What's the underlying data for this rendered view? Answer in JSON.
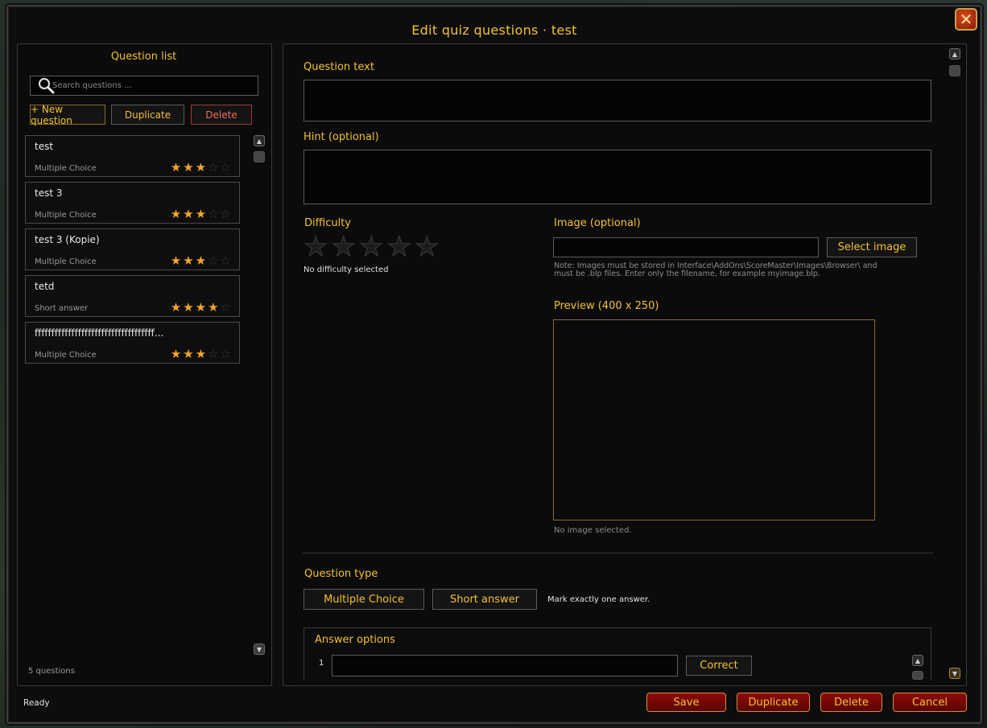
{
  "window": {
    "title": "Edit quiz questions · test",
    "close_glyph": "✕"
  },
  "sidebar": {
    "heading": "Question list",
    "search_placeholder": "Search questions ...",
    "new_label": "+ New question",
    "duplicate_label": "Duplicate",
    "delete_label": "Delete",
    "items": [
      {
        "title": "test",
        "type": "Multiple Choice",
        "difficulty": 3
      },
      {
        "title": "test 3",
        "type": "Multiple Choice",
        "difficulty": 3
      },
      {
        "title": "test 3 (Kopie)",
        "type": "Multiple Choice",
        "difficulty": 3
      },
      {
        "title": "tetd",
        "type": "Short answer",
        "difficulty": 4
      },
      {
        "title": "ffffffffffffffffffffffffffffffffffff...",
        "type": "Multiple Choice",
        "difficulty": 3
      }
    ],
    "count_text": "5 questions"
  },
  "editor": {
    "question_label": "Question text",
    "question_value": "",
    "hint_label": "Hint (optional)",
    "hint_value": "",
    "difficulty_label": "Difficulty",
    "difficulty_value": 0,
    "difficulty_status": "No difficulty selected",
    "image_label": "Image (optional)",
    "image_value": "",
    "select_image_label": "Select image",
    "image_note": "Note: Images must be stored in Interface\\AddOns\\ScoreMaster\\Images\\Browser\\ and must be .blp files. Enter only the filename, for example myimage.blp.",
    "preview_label": "Preview (400 x 250)",
    "preview_status": "No image selected.",
    "type_label": "Question type",
    "type_mc_label": "Multiple Choice",
    "type_short_label": "Short answer",
    "type_hint": "Mark exactly one answer.",
    "answers_label": "Answer options",
    "answers": [
      {
        "index": "1",
        "value": "",
        "correct_label": "Correct"
      }
    ]
  },
  "footer": {
    "status": "Ready",
    "save_label": "Save",
    "duplicate_label": "Duplicate",
    "delete_label": "Delete",
    "cancel_label": "Cancel"
  },
  "colors": {
    "accent": "#f4c230",
    "star_on": "#f5a623",
    "danger": "#f26b5a",
    "button_red": "#8d0a08"
  },
  "icons": [
    "search-icon",
    "close-icon",
    "star-icon",
    "scroll-up-icon",
    "scroll-down-icon"
  ]
}
